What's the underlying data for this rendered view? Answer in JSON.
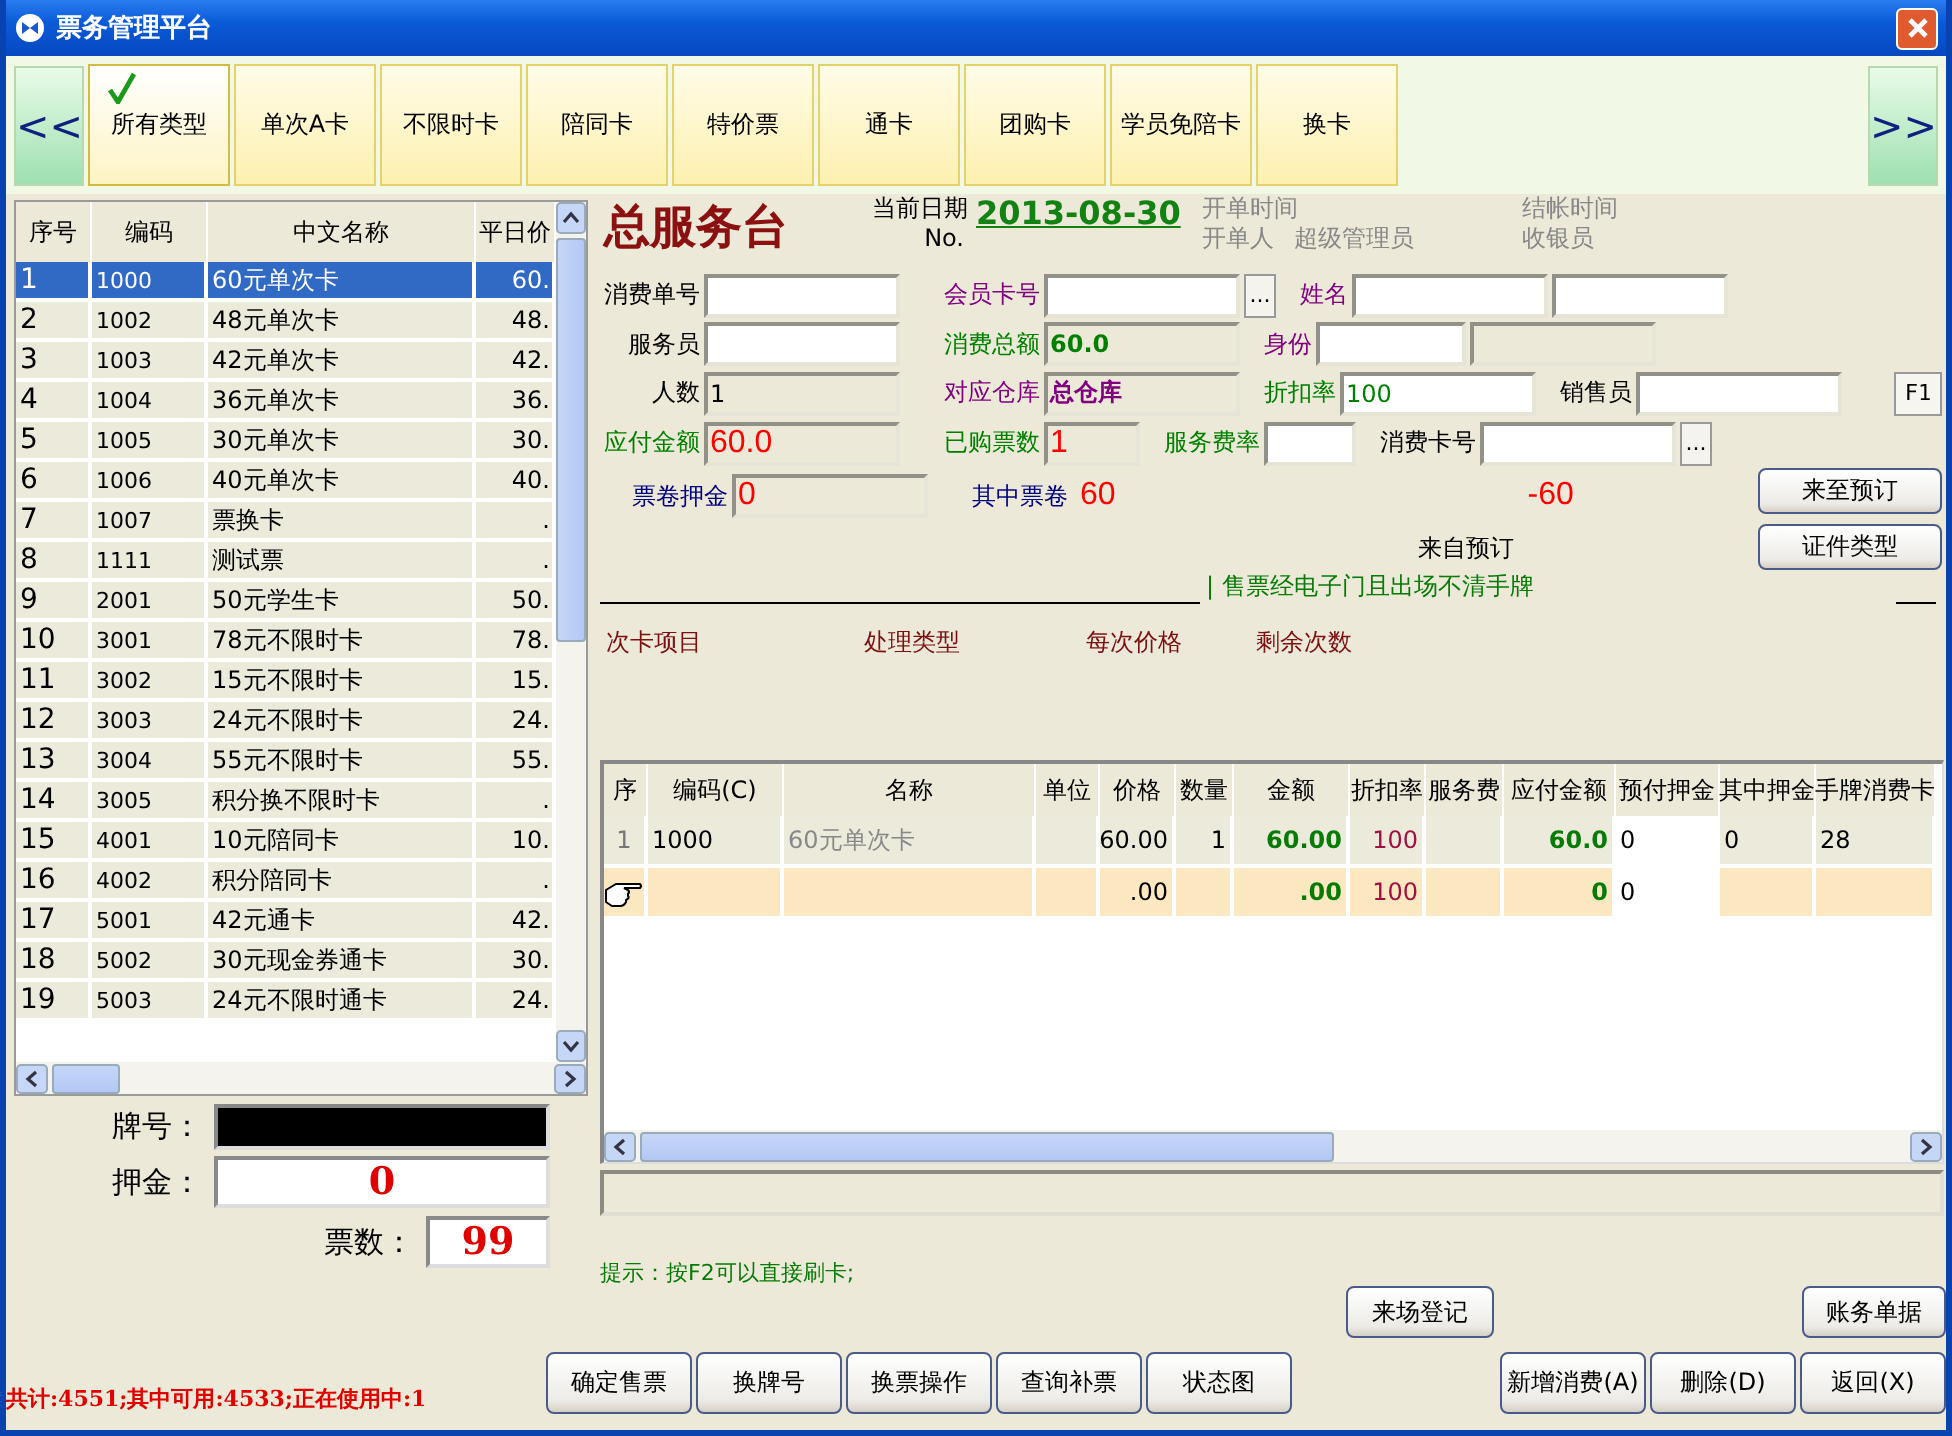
{
  "window": {
    "title": "票务管理平台"
  },
  "nav": {
    "prev": "<<",
    "next": ">>"
  },
  "categories": [
    {
      "label": "所有类型",
      "selected": true
    },
    {
      "label": "单次A卡",
      "selected": false
    },
    {
      "label": "不限时卡",
      "selected": false
    },
    {
      "label": "陪同卡",
      "selected": false
    },
    {
      "label": "特价票",
      "selected": false
    },
    {
      "label": "通卡",
      "selected": false
    },
    {
      "label": "团购卡",
      "selected": false
    },
    {
      "label": "学员免陪卡",
      "selected": false
    },
    {
      "label": "换卡",
      "selected": false
    }
  ],
  "card_table": {
    "columns": [
      "序号",
      "编码",
      "中文名称",
      "平日价"
    ],
    "rows": [
      {
        "cells": [
          "1",
          "1000",
          "60元单次卡",
          "60."
        ],
        "selected": true
      },
      {
        "cells": [
          "2",
          "1002",
          "48元单次卡",
          "48."
        ],
        "selected": false
      },
      {
        "cells": [
          "3",
          "1003",
          "42元单次卡",
          "42."
        ],
        "selected": false
      },
      {
        "cells": [
          "4",
          "1004",
          "36元单次卡",
          "36."
        ],
        "selected": false
      },
      {
        "cells": [
          "5",
          "1005",
          "30元单次卡",
          "30."
        ],
        "selected": false
      },
      {
        "cells": [
          "6",
          "1006",
          "40元单次卡",
          "40."
        ],
        "selected": false
      },
      {
        "cells": [
          "7",
          "1007",
          "票换卡",
          "."
        ],
        "selected": false
      },
      {
        "cells": [
          "8",
          "1111",
          "测试票",
          "."
        ],
        "selected": false
      },
      {
        "cells": [
          "9",
          "2001",
          "50元学生卡",
          "50."
        ],
        "selected": false
      },
      {
        "cells": [
          "10",
          "3001",
          "78元不限时卡",
          "78."
        ],
        "selected": false
      },
      {
        "cells": [
          "11",
          "3002",
          "15元不限时卡",
          "15."
        ],
        "selected": false
      },
      {
        "cells": [
          "12",
          "3003",
          "24元不限时卡",
          "24."
        ],
        "selected": false
      },
      {
        "cells": [
          "13",
          "3004",
          "55元不限时卡",
          "55."
        ],
        "selected": false
      },
      {
        "cells": [
          "14",
          "3005",
          "积分换不限时卡",
          "."
        ],
        "selected": false
      },
      {
        "cells": [
          "15",
          "4001",
          "10元陪同卡",
          "10."
        ],
        "selected": false
      },
      {
        "cells": [
          "16",
          "4002",
          "积分陪同卡",
          "."
        ],
        "selected": false
      },
      {
        "cells": [
          "17",
          "5001",
          "42元通卡",
          "42."
        ],
        "selected": false
      },
      {
        "cells": [
          "18",
          "5002",
          "30元现金券通卡",
          "30."
        ],
        "selected": false
      },
      {
        "cells": [
          "19",
          "5003",
          "24元不限时通卡",
          "24."
        ],
        "selected": false
      }
    ]
  },
  "left_fields": [
    {
      "label": "牌号：",
      "kind": "dark"
    },
    {
      "label": "押金：",
      "kind": "value",
      "value": "0"
    },
    {
      "label": "票数：",
      "kind": "value",
      "value": "99"
    }
  ],
  "desk": {
    "title": "总服务台",
    "date_label": "当前日期",
    "no_label": "No.",
    "date": "2013-08-30",
    "open_time_label": "开单时间",
    "opener_label": "开单人",
    "opener": "超级管理员",
    "close_time_label": "结帐时间",
    "cashier_label": "收银员"
  },
  "form": {
    "rows": [
      {
        "fields": [
          {
            "label": "消费单号",
            "color": "#000000",
            "inputs": [
              {
                "kind": "input"
              }
            ]
          },
          {
            "label": "会员卡号",
            "color": "#800080",
            "inputs": [
              {
                "kind": "input"
              },
              {
                "kind": "lookup",
                "text": "..."
              }
            ]
          },
          {
            "label": "姓名",
            "color": "#800080",
            "inputs": [
              {
                "kind": "input"
              },
              {
                "kind": "input"
              }
            ]
          }
        ]
      },
      {
        "fields": [
          {
            "label": "服务员",
            "color": "#000000",
            "inputs": [
              {
                "kind": "input"
              }
            ]
          },
          {
            "label": "消费总额",
            "color": "#008000",
            "inputs": [
              {
                "kind": "readonly",
                "value": "60.0",
                "color": "#008000",
                "bold": true
              }
            ]
          },
          {
            "label": "身份",
            "color": "#800080",
            "inputs": [
              {
                "kind": "input"
              },
              {
                "kind": "readonly"
              }
            ]
          }
        ]
      },
      {
        "fields": [
          {
            "label": "人数",
            "color": "#000000",
            "inputs": [
              {
                "kind": "readonly",
                "value": "1",
                "color": "#000000",
                "bold": false
              }
            ]
          },
          {
            "label": "对应仓库",
            "color": "#800080",
            "inputs": [
              {
                "kind": "readonly",
                "value": "总仓库",
                "color": "#800080",
                "bold": true
              }
            ]
          },
          {
            "label": "折扣率",
            "color": "#008000",
            "inputs": [
              {
                "kind": "input",
                "value": "100",
                "color": "#008000",
                "bold": false
              }
            ]
          },
          {
            "label": "销售员",
            "color": "#000000",
            "inputs": [
              {
                "kind": "input"
              }
            ]
          }
        ],
        "button": "F1"
      },
      {
        "fields": [
          {
            "label": "应付金额",
            "color": "#008000",
            "inputs": [
              {
                "kind": "amount",
                "value": "60.0",
                "color": "#ff0000",
                "bold": false
              }
            ]
          },
          {
            "label": "已购票数",
            "color": "#008000",
            "inputs": [
              {
                "kind": "amount",
                "value": "1",
                "color": "#ff0000",
                "bold": false
              }
            ]
          },
          {
            "label": "服务费率",
            "color": "#008000",
            "inputs": [
              {
                "kind": "input"
              }
            ]
          },
          {
            "label": "消费卡号",
            "color": "#000000",
            "inputs": [
              {
                "kind": "input"
              },
              {
                "kind": "lookup",
                "text": "..."
              }
            ]
          }
        ]
      },
      {
        "fields": [
          {
            "label": "票卷押金",
            "color": "#000080",
            "inputs": [
              {
                "kind": "amount",
                "value": "0",
                "color": "#ff0000",
                "bold": false
              }
            ]
          },
          {
            "label": "其中票卷",
            "color": "#000080",
            "inputs": [
              {
                "kind": "text",
                "value": "60",
                "color": "#ff0000",
                "bold": false
              }
            ]
          },
          {
            "inputs": [
              {
                "kind": "text",
                "value": "-60",
                "color": "#ff0000",
                "bold": false
              }
            ]
          }
        ]
      }
    ],
    "side_buttons": [
      "来至预订",
      "证件类型"
    ],
    "source_label": "来自预订"
  },
  "notice": "| 售票经电子门且出场不清手牌",
  "card_headers": [
    "次卡项目",
    "处理类型",
    "每次价格",
    "剩余次数"
  ],
  "sales_table": {
    "columns": [
      "序",
      "编码(C)",
      "名称",
      "单位",
      "价格",
      "数量",
      "金额",
      "折扣率",
      "服务费",
      "应付金额",
      "预付押金",
      "其中押金",
      "手牌消费卡"
    ],
    "rows": [
      {
        "selected": false,
        "cells": [
          "1",
          "1000",
          "60元单次卡",
          null,
          "60.00",
          "1",
          "60.00",
          "100",
          null,
          "60.0",
          "0",
          "0",
          "28"
        ]
      },
      {
        "selected": true,
        "cells": [
          null,
          null,
          null,
          null,
          ".00",
          null,
          ".00",
          "100",
          null,
          "0",
          "0",
          null,
          null
        ]
      }
    ]
  },
  "hint": "提示：按F2可以直接刷卡;",
  "top_actions": [
    "来场登记",
    "账务单据"
  ],
  "summary": "共计:4551;其中可用:4533;正在使用中:1",
  "actions": [
    "确定售票",
    "换牌号",
    "换票操作",
    "查询补票",
    "状态图"
  ],
  "right_actions": [
    "新增消费(A)",
    "删除(D)",
    "返回(X)"
  ]
}
